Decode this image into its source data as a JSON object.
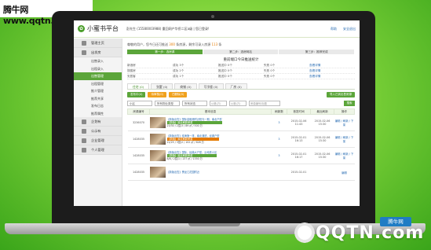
{
  "site_watermark": "腾牛网 www.qqtn.com",
  "corner_watermark": {
    "text": "QQTN.com",
    "badge": "腾牛网"
  },
  "app": {
    "brand": "小蜜书平台",
    "greeting": "彭先生 (15580003988) 重回网产华侨二区a级 | 您已登录!",
    "top_links": [
      "帮助",
      "安全退出"
    ]
  },
  "sidebar": {
    "groups": [
      {
        "label": "管理主页",
        "items": []
      },
      {
        "label": "出发房",
        "items": [
          "出售录入",
          "出租录入",
          "出售管理",
          "出租管理",
          "推介管理",
          "推荐共享",
          "发布日志",
          "推荐属性"
        ]
      },
      {
        "label": "企划有",
        "items": []
      },
      {
        "label": "公示有",
        "items": []
      },
      {
        "label": "企业管理",
        "items": []
      },
      {
        "label": "个人管理",
        "items": []
      }
    ],
    "active_item": "出售管理"
  },
  "notice": {
    "prefix": "尊敬的用户，您今日还可推送",
    "count": "300",
    "mid": "条房源，剩余可录入房源",
    "remain": "113",
    "suffix": "条"
  },
  "steps": [
    "第一步：选房源",
    "第二步：选房网站",
    "第三步：推荐完成"
  ],
  "stats": {
    "title": "重前端口今日推送统计",
    "rows": [
      {
        "site": "新浪房",
        "success": "成功 3个",
        "pending": "推送中 0个",
        "fail": "失败 0个",
        "link": "查看详情"
      },
      {
        "site": "搜狐房",
        "success": "成功 2个",
        "pending": "推送中 0个",
        "fail": "失败 0个",
        "link": "查看详情"
      },
      {
        "site": "安居客",
        "success": "成功 1个",
        "pending": "推送中 0个",
        "fail": "失败 0个",
        "link": "查看详情"
      }
    ]
  },
  "tabs": [
    {
      "label": "住宅 (0)",
      "active": true
    },
    {
      "label": "别墅 (0)",
      "active": false
    },
    {
      "label": "商铺 (0)",
      "active": false
    },
    {
      "label": "写字楼 (0)",
      "active": false
    },
    {
      "label": "厂房 (0)",
      "active": false
    }
  ],
  "filters": [
    "发布中(4)",
    "待审核(0)",
    "已删除(0)"
  ],
  "export_label": "导入已到出售房源",
  "search": {
    "district": "小区",
    "property_type": "所有物业类型",
    "status": "所有状态",
    "placeholder_min": "价格(万)",
    "placeholder_max": "价格(万)",
    "placeholder_kw": "房源编号/标题",
    "button": "搜索"
  },
  "table": {
    "headers": [
      "房源编号",
      "基本信息",
      "刷新数",
      "首发时间",
      "最近刷新",
      "操作"
    ],
    "rows": [
      {
        "id": "3236070",
        "title": "【新版出售】国际金融港附近阳光一期，南北户型",
        "line2": "【新版】最近刷新房源",
        "line3": "23/30 / 2层/3 / 89 ㎡ / 500 万",
        "refresh": "3",
        "first": "2015-02-06 11:43",
        "last": "2015-02-06 15:30",
        "ops": "编辑 / 刷新 / 下架"
      },
      {
        "id": "1428035",
        "title": "【新版出售】临海第一排，南北通透，经典户型",
        "line2": "【新版】最近刷新房源",
        "line3": "21/25 / 3层/2 / 102 ㎡ / 628 万",
        "refresh": "3",
        "first": "2015-02-01 16:13",
        "last": "2015-02-06 15:30",
        "ops": "编辑 / 刷新 / 下架"
      },
      {
        "id": "1428035",
        "title": "【新版出售】国际，经典大户型，近地铁小区",
        "line2": "【新版】最近刷新房源",
        "line3": "8/8 / 2层/1 / 137 ㎡ / 1350 万",
        "refresh": "3",
        "first": "2015-02-01 16:17",
        "last": "2015-02-06 15:30",
        "ops": "编辑 / 刷新 / 下架"
      },
      {
        "id": "1428035",
        "title": "【新版出售】黑龙江花园附近",
        "line2": "",
        "line3": "",
        "refresh": "",
        "first": "2015-02-01",
        "last": "",
        "ops": "编辑"
      }
    ]
  }
}
